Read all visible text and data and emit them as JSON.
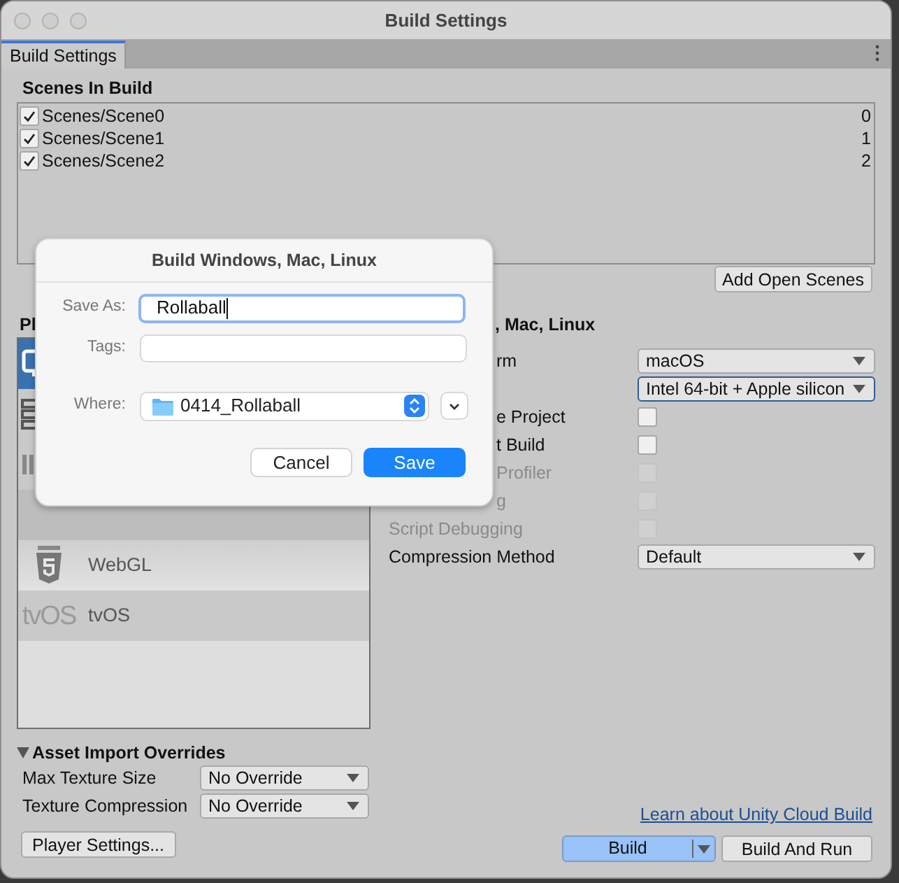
{
  "window": {
    "title": "Build Settings"
  },
  "tabs": [
    {
      "label": "Build Settings",
      "selected": true
    }
  ],
  "scenes": {
    "title": "Scenes In Build",
    "items": [
      {
        "path": "Scenes/Scene0",
        "index": "0",
        "checked": true
      },
      {
        "path": "Scenes/Scene1",
        "index": "1",
        "checked": true
      },
      {
        "path": "Scenes/Scene2",
        "index": "2",
        "checked": true
      }
    ]
  },
  "add_open_scenes_button": "Add Open Scenes",
  "platforms": {
    "title": "Pl",
    "items": [
      {
        "kind": "monitor",
        "selected": true
      },
      {
        "kind": "server",
        "selected": false
      },
      {
        "kind": "bars",
        "selected": false
      },
      {
        "kind": "covered",
        "selected": false
      },
      {
        "kind": "html5",
        "label": "WebGL",
        "selected": false
      },
      {
        "kind": "text",
        "icon_text": "tvOS",
        "label": "tvOS",
        "selected": false
      }
    ]
  },
  "settings": {
    "title": ", Mac, Linux",
    "rows": [
      {
        "kind": "dropdown",
        "label": "rm",
        "value": "macOS",
        "focused": false
      },
      {
        "kind": "dropdown",
        "value": "Intel 64-bit + Apple silicon",
        "focused": true
      },
      {
        "kind": "checkbox",
        "label": "e Project",
        "checked": false,
        "disabled": false
      },
      {
        "kind": "checkbox",
        "label": "t Build",
        "checked": false,
        "disabled": false
      },
      {
        "kind": "checkbox",
        "label": "Profiler",
        "checked": false,
        "disabled": true
      },
      {
        "kind": "checkbox",
        "label": "g",
        "checked": false,
        "disabled": true
      },
      {
        "kind": "checkbox",
        "label": "Script Debugging",
        "checked": false,
        "disabled": true
      },
      {
        "kind": "dropdown",
        "label": "Compression Method",
        "value": "Default",
        "focused": false
      }
    ]
  },
  "asset_import_overrides": {
    "title": "Asset Import Overrides",
    "expanded": true,
    "rows": [
      {
        "label": "Max Texture Size",
        "value": "No Override"
      },
      {
        "label": "Texture Compression",
        "value": "No Override"
      }
    ]
  },
  "player_settings_button": "Player Settings...",
  "cloud_build_link": "Learn about Unity Cloud Build",
  "build_button": "Build",
  "build_and_run_button": "Build And Run",
  "dialog": {
    "title": "Build Windows, Mac, Linux",
    "save_as": {
      "label": "Save As:",
      "value": "Rollaball"
    },
    "tags": {
      "label": "Tags:"
    },
    "where": {
      "label": "Where:",
      "value": "0414_Rollaball"
    },
    "buttons": [
      {
        "label": "Cancel",
        "primary": false
      },
      {
        "label": "Save",
        "primary": true
      }
    ]
  }
}
